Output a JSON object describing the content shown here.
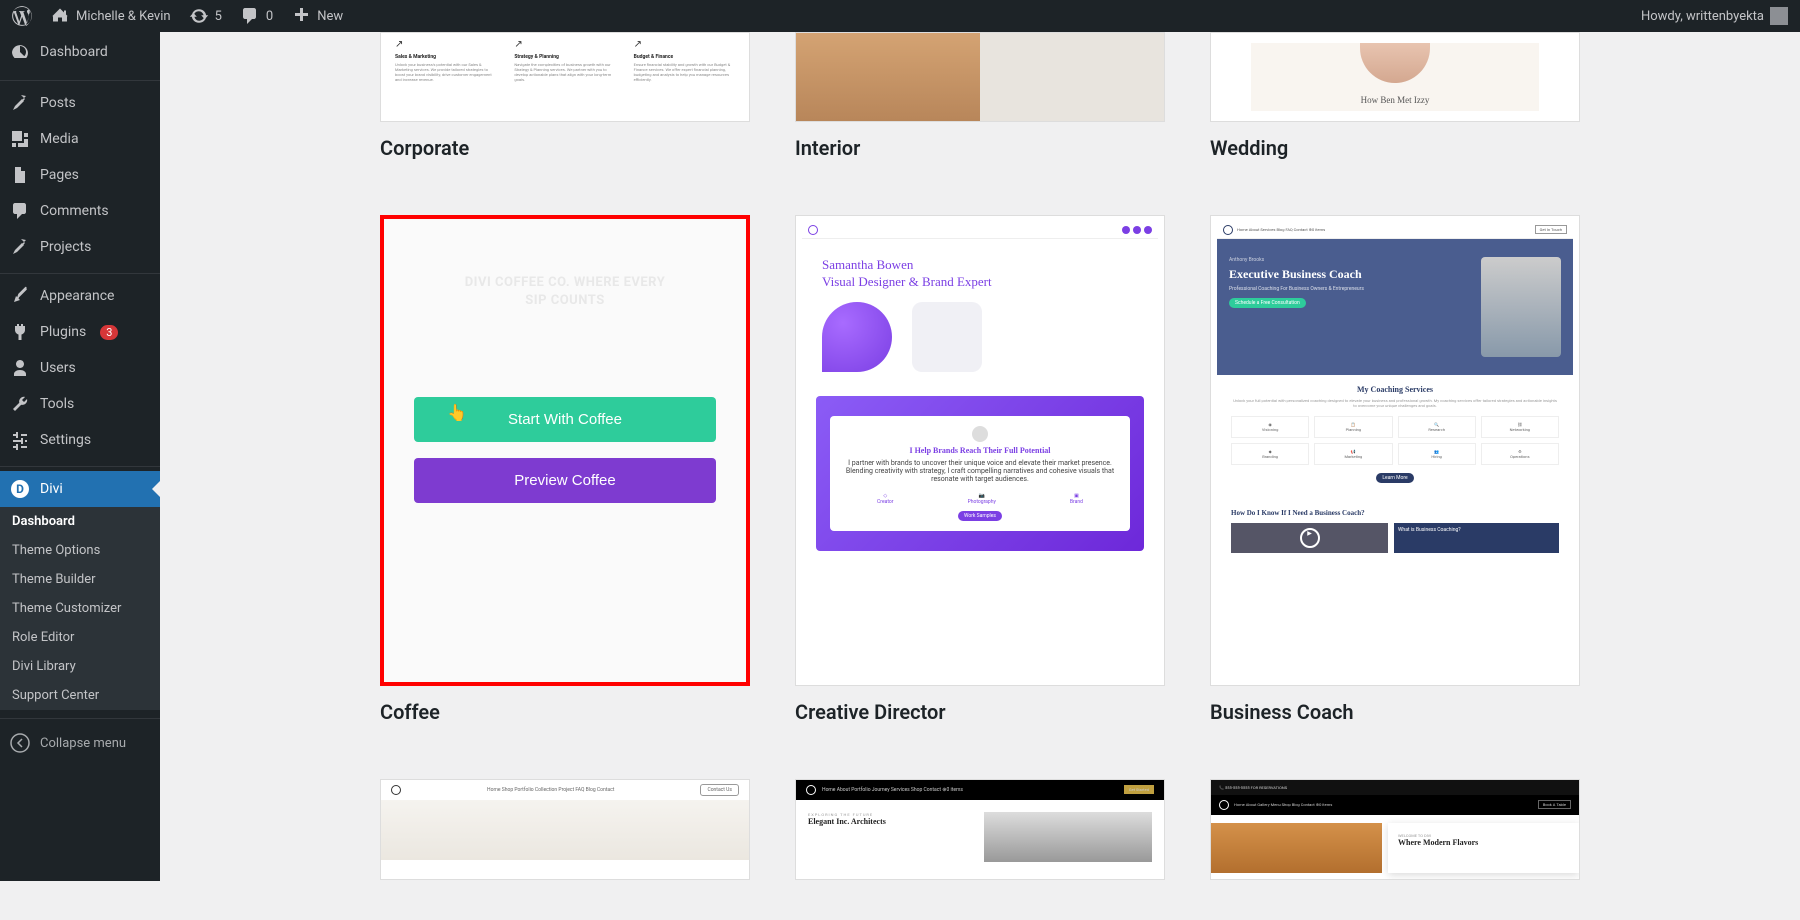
{
  "adminbar": {
    "site_name": "Michelle & Kevin",
    "updates_count": "5",
    "comments_count": "0",
    "new_label": "New",
    "howdy": "Howdy, writtenbyekta"
  },
  "sidebar": {
    "dashboard": "Dashboard",
    "posts": "Posts",
    "media": "Media",
    "pages": "Pages",
    "comments": "Comments",
    "projects": "Projects",
    "appearance": "Appearance",
    "plugins": "Plugins",
    "plugins_badge": "3",
    "users": "Users",
    "tools": "Tools",
    "settings": "Settings",
    "divi": "Divi",
    "collapse": "Collapse menu"
  },
  "divi_submenu": {
    "dashboard": "Dashboard",
    "theme_options": "Theme Options",
    "theme_builder": "Theme Builder",
    "theme_customizer": "Theme Customizer",
    "role_editor": "Role Editor",
    "divi_library": "Divi Library",
    "support_center": "Support Center"
  },
  "grid": {
    "row1": {
      "c1": "Corporate",
      "c2": "Interior",
      "c3": "Wedding"
    },
    "row2": {
      "c1": "Coffee",
      "c2": "Creative Director",
      "c3": "Business Coach"
    }
  },
  "overlay": {
    "hero_line1": "DIVI COFFEE CO. WHERE EVERY",
    "hero_line2": "SIP COUNTS",
    "start": "Start With Coffee",
    "preview": "Preview Coffee"
  },
  "thumbs": {
    "corporate": {
      "col1_h": "Sales & Marketing",
      "col1_t": "Unlock your business's potential with our Sales & Marketing services. We provide tailored strategies to boost your brand visibility, drive customer engagement and increase revenue.",
      "col2_h": "Strategy & Planning",
      "col2_t": "Navigate the complexities of business growth with our Strategy & Planning services. We partner with you to develop actionable plans that align with your long-term goals.",
      "col3_h": "Budget & Finance",
      "col3_t": "Ensure financial stability and growth with our Budget & Finance services. We offer expert financial planning, budgeting and analysis to help you manage resources efficiently."
    },
    "wedding": {
      "caption": "How Ben Met Izzy"
    },
    "creative_director": {
      "name_line1": "Samantha Bowen",
      "name_line2": "Visual Designer & Brand Expert",
      "panel_title": "I Help Brands Reach Their Full Potential",
      "panel_desc": "I partner with brands to uncover their unique voice and elevate their market presence. Blending creativity with strategy, I craft compelling narratives and cohesive visuals that resonate with target audiences.",
      "pill": "Work Samples",
      "tab1": "Creator",
      "tab2": "Photography",
      "tab3": "Brand"
    },
    "business_coach": {
      "hero_title": "Executive Business Coach",
      "hero_sub": "Professional Coaching For Business Owners & Entrepreneurs",
      "hero_btn": "Schedule a Free Consultation",
      "services_h": "My Coaching Services",
      "services_p": "Unlock your full potential with personalized coaching designed to elevate your business and professional growth. My coaching services offer tailored strategies and actionable insights to overcome your unique challenges and goals.",
      "s1": "Visioning",
      "s2": "Planning",
      "s3": "Research",
      "s4": "Networking",
      "s5": "Branding",
      "s6": "Marketing",
      "s7": "Hiring",
      "s8": "Operations",
      "more": "Learn More",
      "know_h": "How Do I Know If I Need a Business Coach?",
      "know_box": "What is Business Coaching?"
    },
    "furniture": {
      "contact": "Contact Us"
    },
    "architect": {
      "subtitle": "EXPLORING THE FUTURE",
      "title": "Elegant Inc. Architects"
    },
    "flavors": {
      "title": "Where Modern Flavors"
    }
  }
}
